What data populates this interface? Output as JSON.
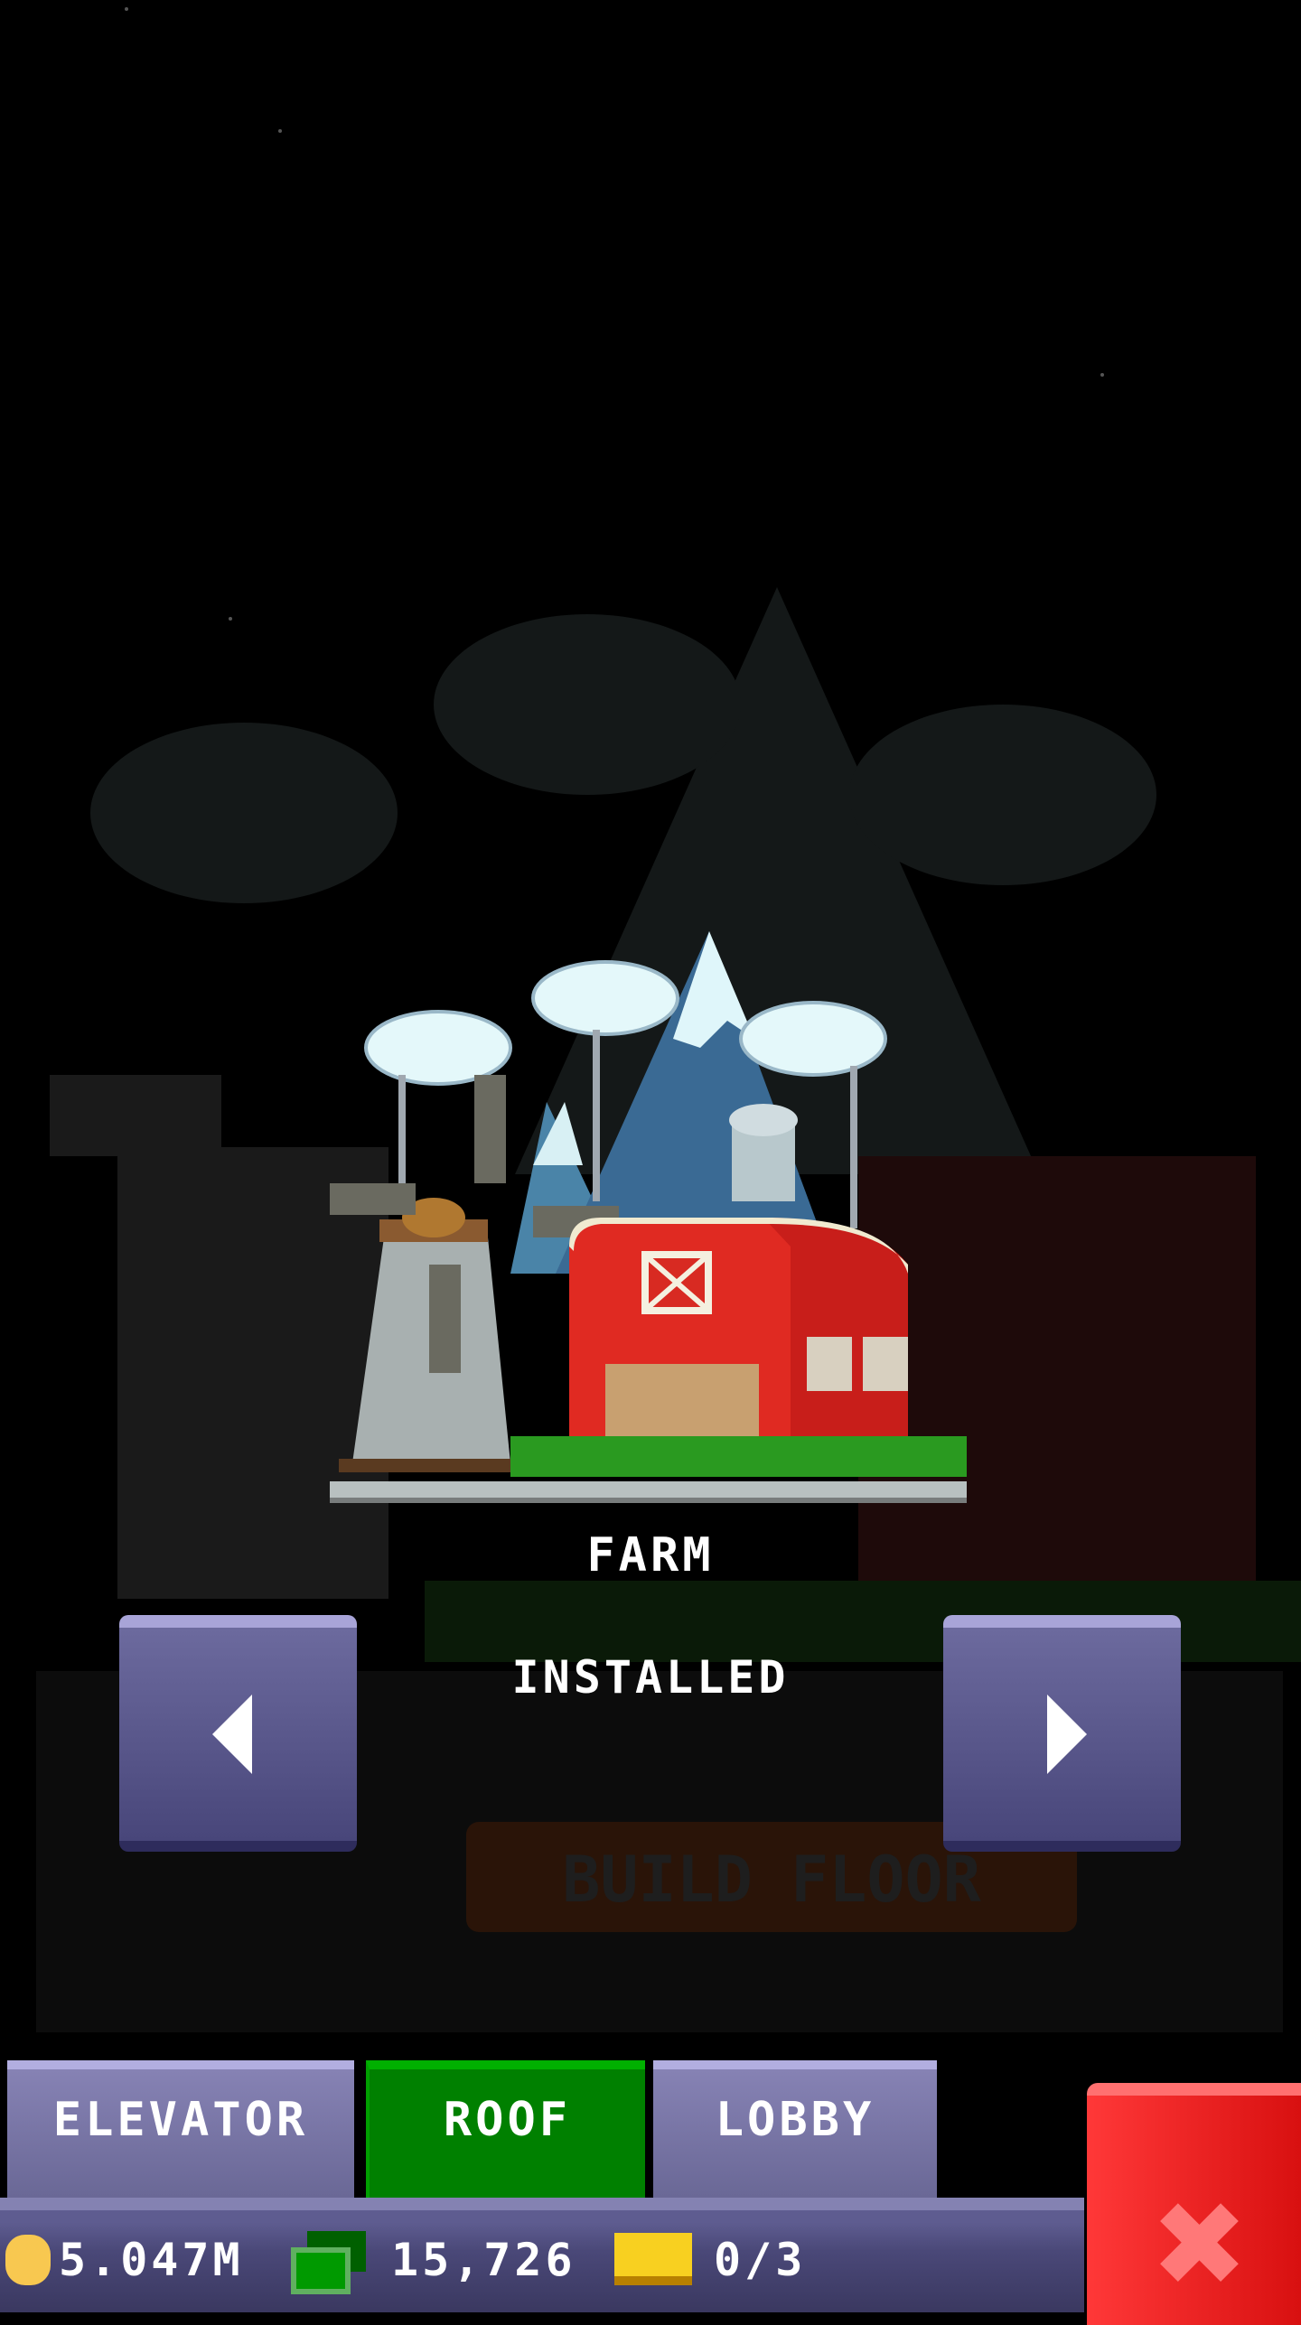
{
  "item": {
    "name": "FARM",
    "status": "INSTALLED"
  },
  "background": {
    "build_floor_label": "BUILD FLOOR"
  },
  "tabs": [
    {
      "label": "ELEVATOR",
      "active": false
    },
    {
      "label": "ROOF",
      "active": true
    },
    {
      "label": "LOBBY",
      "active": false
    }
  ],
  "currency": {
    "coins": "5.047M",
    "bux": "15,726",
    "tickets": "0/3"
  },
  "colors": {
    "active_tab": "#008000",
    "tab": "#7a78aa",
    "close": "#e82020",
    "nav_button": "#5c5a8e"
  }
}
